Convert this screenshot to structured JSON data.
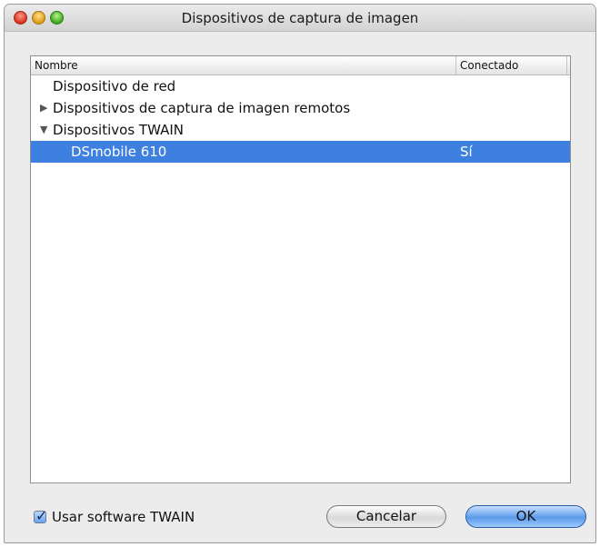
{
  "window": {
    "title": "Dispositivos de captura de imagen"
  },
  "table": {
    "columns": [
      "Nombre",
      "Conectado"
    ],
    "rows": [
      {
        "name": "Dispositivo de red",
        "connected": "",
        "disclosure": "",
        "selected": false
      },
      {
        "name": "Dispositivos de captura de imagen remotos",
        "connected": "",
        "disclosure": "▶",
        "selected": false
      },
      {
        "name": "Dispositivos TWAIN",
        "connected": "",
        "disclosure": "▼",
        "selected": false
      },
      {
        "name": "DSmobile 610",
        "connected": "Sí",
        "disclosure": "",
        "selected": true
      }
    ]
  },
  "footer": {
    "checkbox_label": "Usar software TWAIN",
    "checkbox_checked": true,
    "cancel_label": "Cancelar",
    "ok_label": "OK"
  },
  "colors": {
    "selection": "#3d80df",
    "default_button": "#5a9bea"
  },
  "icons": {
    "close": "close-icon",
    "minimize": "minimize-icon",
    "zoom": "zoom-icon",
    "collapsed": "disclosure-collapsed-icon",
    "expanded": "disclosure-expanded-icon",
    "check": "checkmark-icon"
  }
}
